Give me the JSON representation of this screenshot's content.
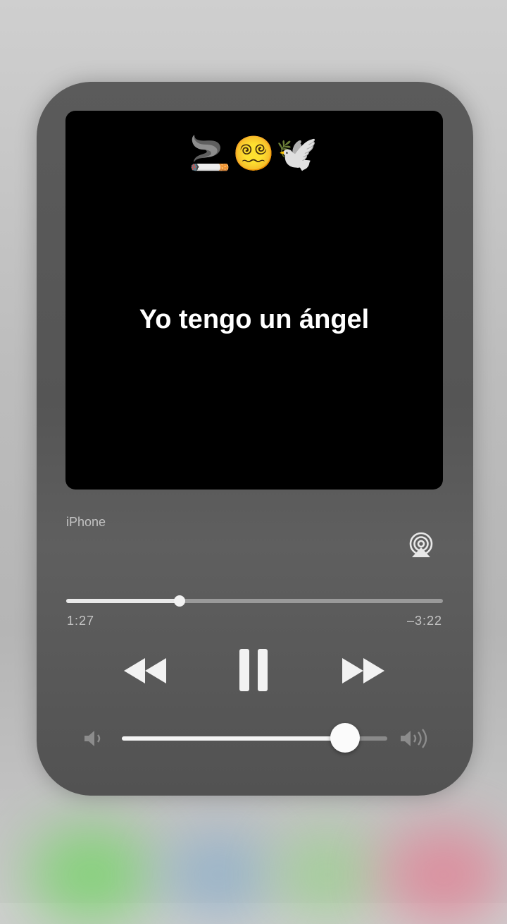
{
  "artwork": {
    "emojis": "🚬😵‍💫🕊️",
    "lyric": "Yo tengo un ángel"
  },
  "output_device": {
    "label": "iPhone",
    "airplay_icon": "airplay-icon"
  },
  "playback": {
    "elapsed": "1:27",
    "remaining": "–3:22",
    "progress_fraction": 0.3
  },
  "controls": {
    "rewind_icon": "rewind-icon",
    "pause_icon": "pause-icon",
    "fast_forward_icon": "fast-forward-icon"
  },
  "volume": {
    "level_fraction": 0.84,
    "low_icon": "speaker-low-icon",
    "high_icon": "speaker-high-icon"
  },
  "colors": {
    "panel": "#555555",
    "artwork_bg": "#000000",
    "accent": "#ffffff"
  }
}
